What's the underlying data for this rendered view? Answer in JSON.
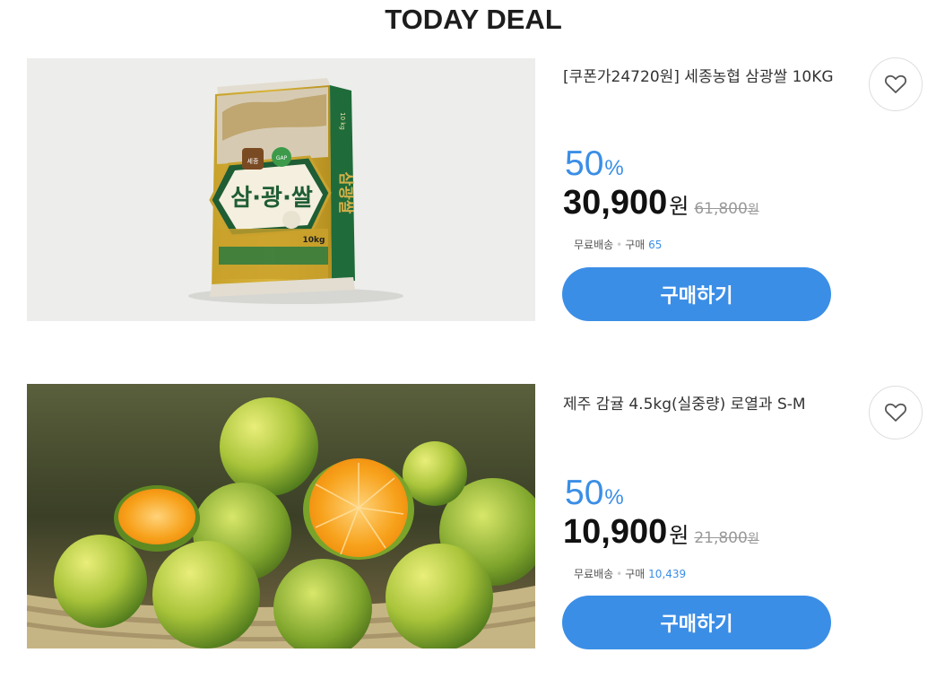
{
  "header": {
    "title": "TODAY DEAL"
  },
  "deals": [
    {
      "name": "[쿠폰가24720원] 세종농협 삼광쌀 10KG",
      "discount_rate": "50",
      "percent_sign": "%",
      "sale_price": "30,900",
      "currency": "원",
      "original_price": "61,800",
      "original_currency": "원",
      "shipping": "무료배송",
      "purchase_label": "구매",
      "purchase_count": "65",
      "buy_label": "구매하기",
      "image": {
        "brand_logo": "세종",
        "gap_badge": "GAP",
        "product_text": "삼·광·쌀",
        "weight_text": "10kg",
        "side_text": "삼광쌀",
        "side_weight": "10 kg"
      }
    },
    {
      "name": "제주 감귤 4.5kg(실중량) 로열과 S-M",
      "discount_rate": "50",
      "percent_sign": "%",
      "sale_price": "10,900",
      "currency": "원",
      "original_price": "21,800",
      "original_currency": "원",
      "shipping": "무료배송",
      "purchase_label": "구매",
      "purchase_count": "10,439",
      "buy_label": "구매하기"
    }
  ],
  "icons": {
    "wishlist": "heart-outline-icon"
  },
  "colors": {
    "accent": "#3b8ee6",
    "title": "#1d1d1d",
    "strike": "#999999"
  }
}
